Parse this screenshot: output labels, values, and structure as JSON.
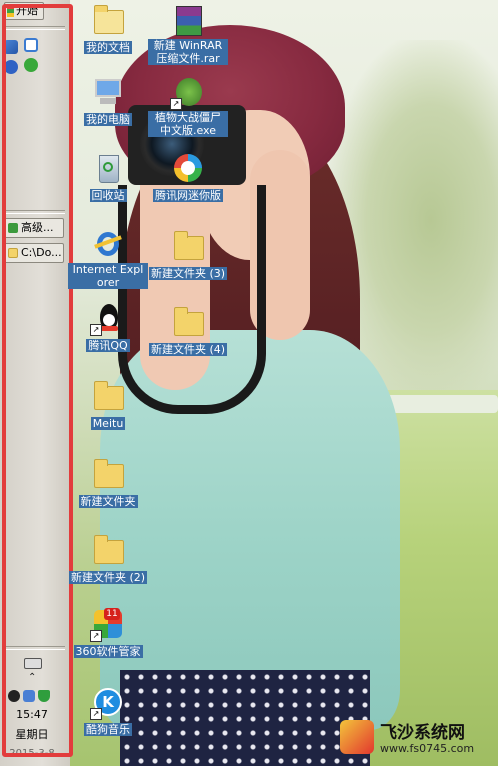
{
  "taskbar": {
    "start_label": "开始",
    "tasks": [
      {
        "label": "高级..."
      },
      {
        "label": "C:\\Do..."
      }
    ],
    "clock": "15:47",
    "weekday": "星期日",
    "date_partial": "2015-3-8"
  },
  "desktop": {
    "icons": [
      {
        "label": "我的文档"
      },
      {
        "label": "新建 WinRAR 压缩文件.rar"
      },
      {
        "label": "我的电脑"
      },
      {
        "label": "植物大战僵尸中文版.exe"
      },
      {
        "label": "回收站"
      },
      {
        "label": "腾讯网迷你版"
      },
      {
        "label": "Internet Explorer"
      },
      {
        "label": "新建文件夹 (3)"
      },
      {
        "label": "腾讯QQ"
      },
      {
        "label": "新建文件夹 (4)"
      },
      {
        "label": "Meitu"
      },
      {
        "label": "新建文件夹"
      },
      {
        "label": "新建文件夹 (2)"
      },
      {
        "label": "360软件管家"
      },
      {
        "label": "酷狗音乐"
      }
    ],
    "badge_360": "11"
  },
  "watermark": {
    "title": "飞沙系统网",
    "url": "www.fs0745.com"
  },
  "colors": {
    "highlight": "#e23c3c",
    "label_bg": "#3a6ea5"
  }
}
